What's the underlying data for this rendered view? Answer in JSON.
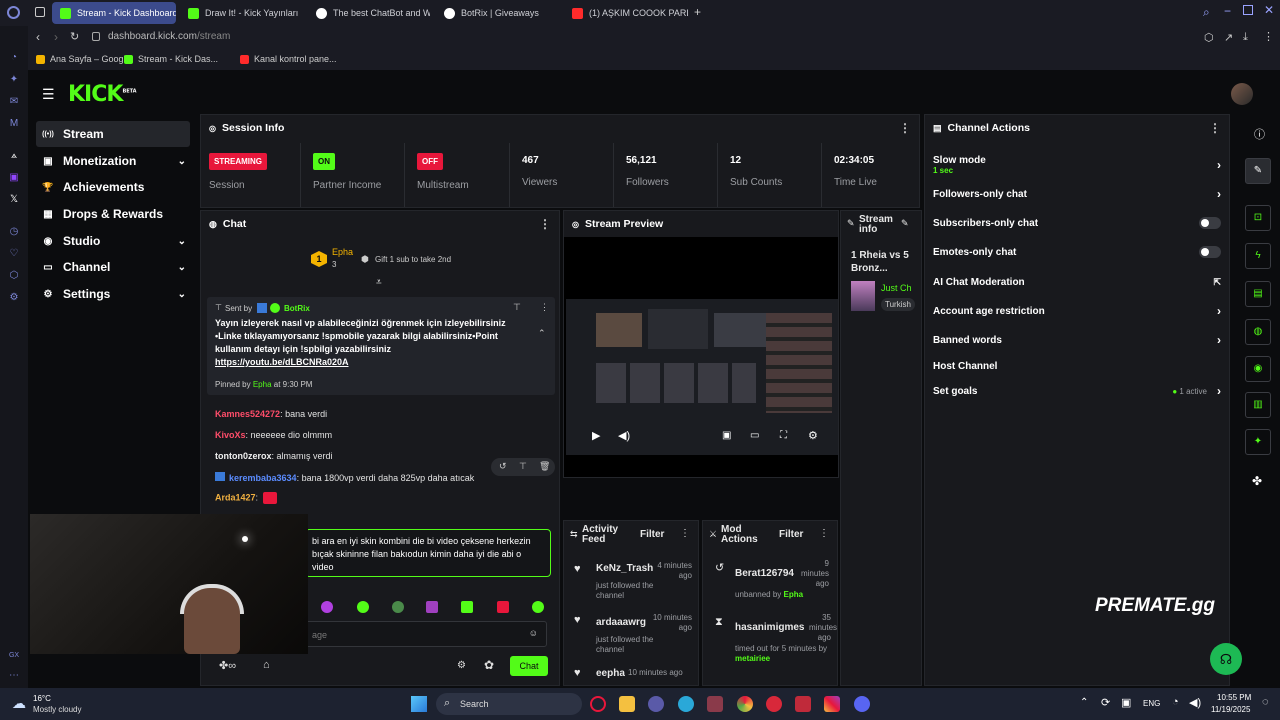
{
  "browser": {
    "tabs": [
      {
        "label": "Stream - Kick Dashboard",
        "color": "#53fc18"
      },
      {
        "label": "Draw It! - Kick Yayınları İç",
        "color": "#53fc18"
      },
      {
        "label": "The best ChatBot and Wi",
        "color": "#ffffff"
      },
      {
        "label": "BotRix | Giveaways",
        "color": "#ffffff"
      },
      {
        "label": "(1) AŞKIM COOOK PARDO",
        "color": "#ff2b2b"
      }
    ],
    "url_host": "dashboard.kick.com",
    "url_path": "/stream",
    "bookmarks": [
      "Ana Sayfa – Googl...",
      "Stream - Kick Das...",
      "Kanal kontrol pane..."
    ]
  },
  "sidebar": {
    "logo": "KICK",
    "logo_sup": "BETA",
    "items": [
      {
        "label": "Stream",
        "icon": "broadcast-icon",
        "glyph": "((•))"
      },
      {
        "label": "Monetization",
        "icon": "money-icon",
        "glyph": "▣"
      },
      {
        "label": "Achievements",
        "icon": "trophy-icon",
        "glyph": "🏆"
      },
      {
        "label": "Drops & Rewards",
        "icon": "gift-icon",
        "glyph": "▦"
      },
      {
        "label": "Studio",
        "icon": "camera-icon",
        "glyph": "◉"
      },
      {
        "label": "Channel",
        "icon": "tv-icon",
        "glyph": "▭"
      },
      {
        "label": "Settings",
        "icon": "gear-icon",
        "glyph": "⚙"
      }
    ]
  },
  "session": {
    "title": "Session Info",
    "stats": [
      {
        "badge": "STREAMING",
        "label": "Session",
        "color": "#e8173b"
      },
      {
        "badge": "ON",
        "label": "Partner Income",
        "color": "#53fc18"
      },
      {
        "badge": "OFF",
        "label": "Multistream",
        "color": "#e8173b"
      },
      {
        "value": "467",
        "label": "Viewers"
      },
      {
        "value": "56,121",
        "label": "Followers"
      },
      {
        "value": "12",
        "label": "Sub Counts"
      },
      {
        "value": "02:34:05",
        "label": "Time Live"
      }
    ]
  },
  "channel_actions": {
    "title": "Channel Actions",
    "slow_mode": "Slow mode",
    "slow_mode_value": "1 sec",
    "items": [
      {
        "label": "Followers-only chat",
        "control": "arrow"
      },
      {
        "label": "Subscribers-only chat",
        "control": "toggle"
      },
      {
        "label": "Emotes-only chat",
        "control": "toggle"
      },
      {
        "label": "AI Chat Moderation",
        "control": "external"
      },
      {
        "label": "Account age restriction",
        "control": "arrow"
      },
      {
        "label": "Banned words",
        "control": "arrow"
      },
      {
        "label": "Host Channel",
        "control": "none"
      },
      {
        "label": "Set goals",
        "control": "arrow"
      }
    ],
    "goals_status": "1 active"
  },
  "chat": {
    "title": "Chat",
    "top_user": "Epha",
    "top_count": "3",
    "top_rank": "1",
    "gift_text": "Gift 1 sub to take 2nd",
    "pinned_sent_by": "Sent by",
    "pinned_author": "BotRix",
    "pinned_text": "Yayın izleyerek nasıl vp alabileceğinizi öğrenmek için izleyebilirsiniz •Linke tıklayamıyorsanız !spmobile yazarak bilgi alabilirsiniz•Point kullanım detayı için !spbilgi yazabilirsiniz",
    "pinned_link": "https://youtu.be/dLBCNRa020A",
    "pinned_by": "Pinned by",
    "pinned_by_user": "Epha",
    "pinned_time": "at 9:30 PM",
    "messages": [
      {
        "user": "Kamnes524272",
        "text": ": bana verdi",
        "color": "#ff4d6a"
      },
      {
        "user": "KivoXs",
        "text": ": neeeeee dio olmmm",
        "color": "#ff4d6a"
      },
      {
        "user": "tonton0zerox",
        "text": ": almamış verdi",
        "color": "#f0f0f0"
      },
      {
        "user": "kerembaba3634",
        "text": ": bana 1800vp verdi daha 825vp daha atıcak",
        "color": "#5b8cff"
      },
      {
        "user": "Arda1427",
        "text": ":",
        "color": "#f0b040"
      }
    ],
    "input_text": "bi ara en iyi skin kombini die bi video çeksene herkezin bıçak skininne filan bakıodun kimin daha iyi die abi o video",
    "send_placeholder": "age",
    "send_button": "Chat"
  },
  "preview": {
    "title": "Stream Preview"
  },
  "stream_info": {
    "title": "Stream info",
    "stream_title": "1 Rheia vs 5 Bronz...",
    "category": "Just Ch",
    "tag": "Turkish"
  },
  "activity": {
    "title": "Activity Feed",
    "filter": "Filter",
    "items": [
      {
        "user": "KeNz_Trash",
        "time": "4 minutes ago",
        "action": "just followed the channel"
      },
      {
        "user": "ardaaawrg",
        "time": "10 minutes ago",
        "action": "just followed the channel"
      },
      {
        "user": "eepha",
        "time": "10 minutes ago",
        "action": ""
      }
    ]
  },
  "mod_actions": {
    "title": "Mod Actions",
    "filter": "Filter",
    "items": [
      {
        "user": "Berat126794",
        "time": "9 minutes ago",
        "action": "unbanned by",
        "by": "Epha"
      },
      {
        "user": "hasanimigmes",
        "time": "35 minutes ago",
        "action": "timed out for 5 minutes by",
        "by": "metairiee"
      }
    ]
  },
  "watermark": "PREMATE.gg",
  "taskbar": {
    "temp": "16°C",
    "weather": "Mostly cloudy",
    "search": "Search",
    "lang": "ENG",
    "time": "10:55 PM",
    "date": "11/19/2025"
  }
}
